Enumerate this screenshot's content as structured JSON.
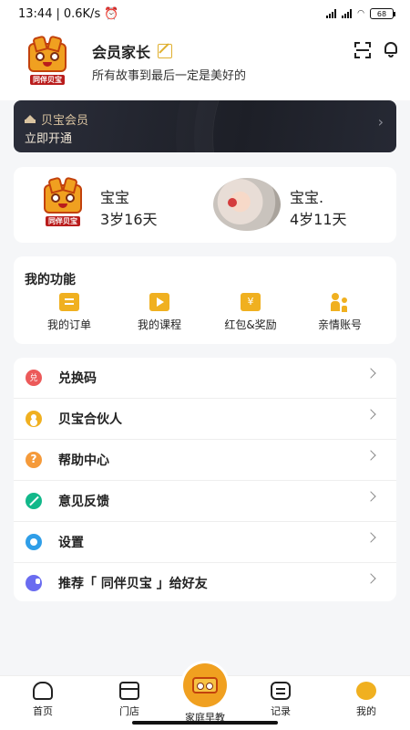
{
  "status_bar": {
    "time": "13:44",
    "speed": "0.6K/s",
    "battery": "68"
  },
  "logo": {
    "text": "同伴贝宝"
  },
  "profile": {
    "name": "会员家长",
    "motto": "所有故事到最后一定是美好的"
  },
  "vip": {
    "title": "贝宝会员",
    "action": "立即开通"
  },
  "babies": [
    {
      "name": "宝宝",
      "age": "3岁16天"
    },
    {
      "name": "宝宝.",
      "age": "4岁11天"
    }
  ],
  "functions": {
    "title": "我的功能",
    "items": [
      {
        "label": "我的订单",
        "icon": "order-icon"
      },
      {
        "label": "我的课程",
        "icon": "course-icon"
      },
      {
        "label": "红包&奖励",
        "icon": "red-packet-icon"
      },
      {
        "label": "亲情账号",
        "icon": "family-icon"
      }
    ]
  },
  "menu": [
    {
      "label": "兑换码",
      "icon": "redeem-icon"
    },
    {
      "label": "贝宝合伙人",
      "icon": "partner-icon"
    },
    {
      "label": "帮助中心",
      "icon": "help-icon"
    },
    {
      "label": "意见反馈",
      "icon": "feedback-icon"
    },
    {
      "label": "设置",
      "icon": "settings-icon"
    },
    {
      "label": "推荐「 同伴贝宝 」给好友",
      "icon": "share-icon"
    }
  ],
  "tabs": [
    {
      "label": "首页",
      "icon": "home-icon"
    },
    {
      "label": "门店",
      "icon": "store-icon"
    },
    {
      "label": "家庭早教",
      "icon": "early-education-icon"
    },
    {
      "label": "记录",
      "icon": "record-icon"
    },
    {
      "label": "我的",
      "icon": "mine-icon"
    }
  ],
  "colors": {
    "accent": "#f0b020",
    "vip_bg": "#1d1f27",
    "vip_text": "#d9c3a0"
  }
}
